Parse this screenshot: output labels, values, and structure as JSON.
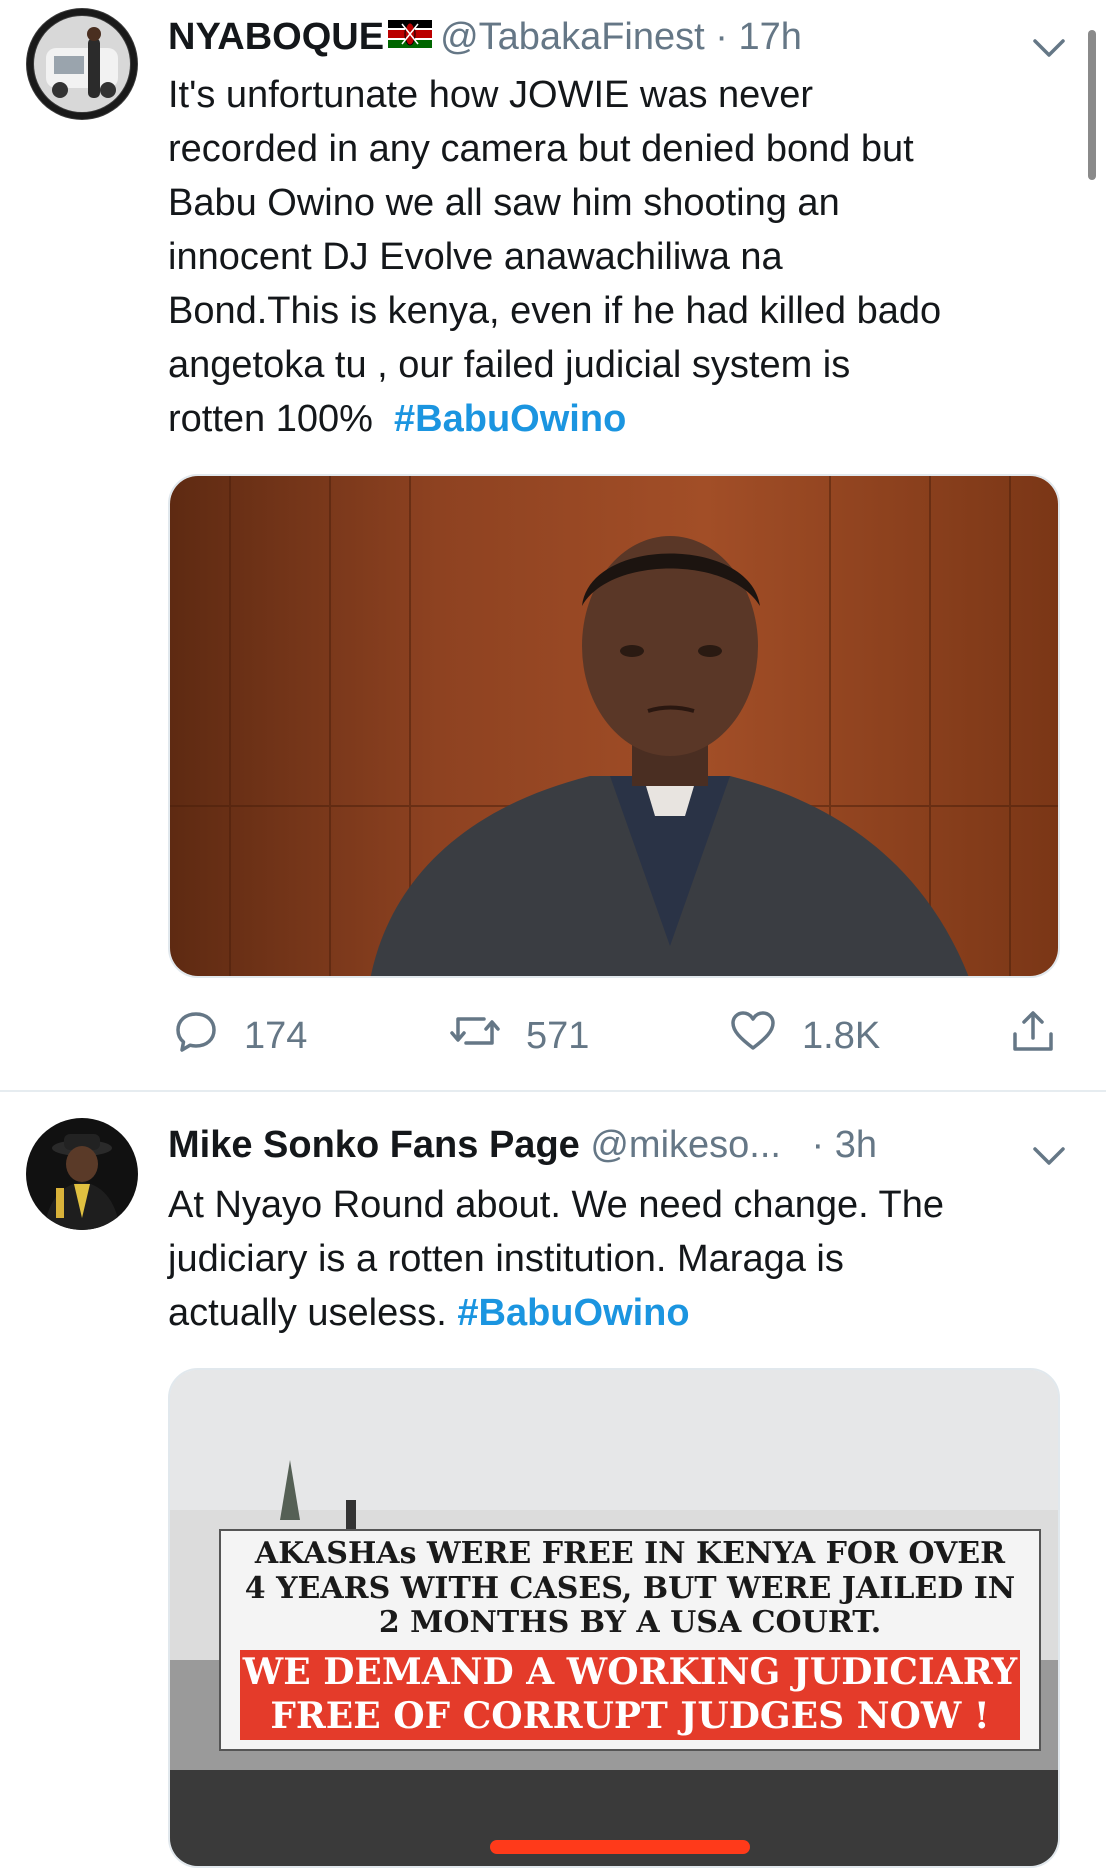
{
  "tweets": [
    {
      "name": "NYABOQUE",
      "handle": "@TabakaFinest",
      "sep": "·",
      "time": "17h",
      "text_lines": [
        "It's unfortunate how JOWIE was never",
        "recorded in any camera but denied bond but",
        "Babu Owino we all saw him shooting an",
        "innocent DJ Evolve anawachiliwa na",
        "Bond.This is kenya, even if he had killed bado",
        "angetoka tu , our failed judicial system is",
        "rotten 100%"
      ],
      "hashtag": "#BabuOwino",
      "replies": "174",
      "retweets": "571",
      "likes": "1.8K"
    },
    {
      "name": "Mike Sonko Fans Page",
      "handle": "@mikeso...",
      "sep": "·",
      "time": "3h",
      "text_lines": [
        "At Nyayo Round about. We need change. The",
        "judiciary is a rotten institution. Maraga is",
        "actually useless."
      ],
      "hashtag": "#BabuOwino",
      "banner": {
        "line1": "AKASHAs WERE FREE IN KENYA FOR OVER",
        "line2": "4 YEARS WITH CASES, BUT WERE JAILED IN",
        "line3": "2 MONTHS BY A USA COURT.",
        "line4": "WE DEMAND A WORKING JUDICIARY",
        "line5": "FREE OF CORRUPT JUDGES NOW !"
      }
    }
  ],
  "icons": {
    "reply": "reply-icon",
    "retweet": "retweet-icon",
    "like": "heart-icon",
    "share": "share-icon",
    "more": "chevron-down-icon"
  },
  "colors": {
    "link": "#1b95e0",
    "secondary": "#657786",
    "text": "#14171a"
  }
}
